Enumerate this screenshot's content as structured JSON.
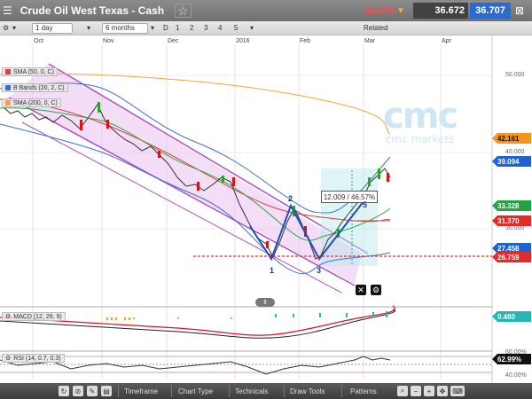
{
  "titlebar": {
    "title": "Crude Oil West Texas - Cash",
    "change": "-22.19%",
    "sell_price": "36.672",
    "buy_price": "36.707"
  },
  "toolbar": {
    "interval": "1 day",
    "range": "6 months",
    "d_label": "D",
    "nums": [
      "1",
      "2",
      "3",
      "4",
      "5"
    ],
    "related": "Related"
  },
  "xaxis": {
    "labels": [
      "Oct",
      "Nov",
      "Dec",
      "2016",
      "Feb",
      "Mar",
      "Apr"
    ]
  },
  "legend": {
    "sma50": "SMA (50, 0, C)",
    "bbands": "B Bands (20, 2, C)",
    "sma200": "SMA (200, 0, C)"
  },
  "logo": {
    "big": "cmc",
    "small": "cmc markets"
  },
  "yaxis": {
    "labels": [
      "50.000",
      "40.000",
      "30.000"
    ]
  },
  "price_tags": [
    {
      "value": "42.161",
      "color": "#f7941d"
    },
    {
      "value": "39.094",
      "color": "#1f62d6"
    },
    {
      "value": "33.328",
      "color": "#22a344"
    },
    {
      "value": "31.370",
      "color": "#e52a2a"
    },
    {
      "value": "27.458",
      "color": "#1f62d6"
    },
    {
      "value": "26.759",
      "color": "#e52a2a"
    }
  ],
  "measure": "12.009 / 46.57%",
  "wave_labels": [
    "1",
    "2",
    "3",
    "5"
  ],
  "macd": {
    "label": "MACD (12, 26, 9)",
    "value": "0.480",
    "color": "#22b8b8"
  },
  "rsi": {
    "label": "RSI (14, 0.7, 0.3)",
    "value": "62.99%",
    "levels": [
      "60.00%",
      "40.00%"
    ]
  },
  "bottombar": {
    "timeframe": "Timeframe",
    "chart_type": "Chart Type",
    "technicals": "Technicals",
    "draw_tools": "Draw Tools",
    "patterns": "Patterns"
  }
}
